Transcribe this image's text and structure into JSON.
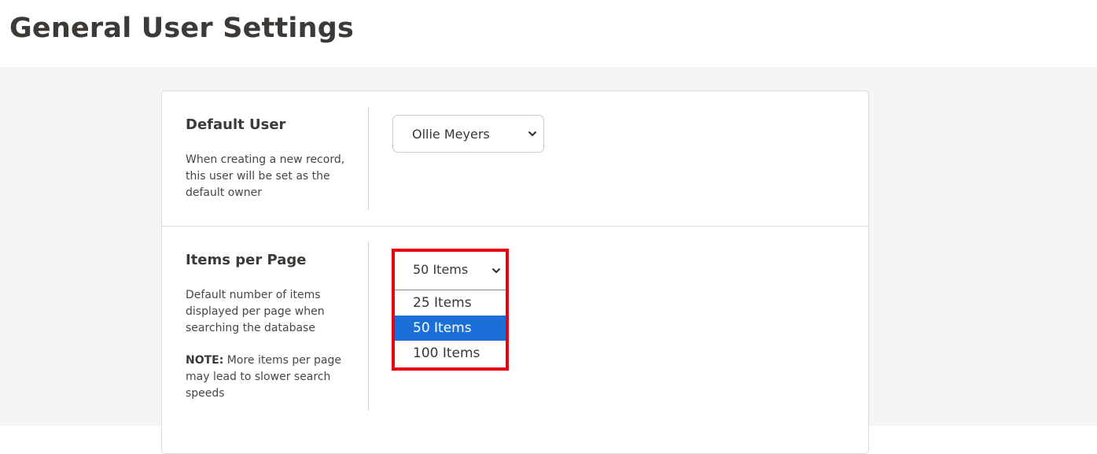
{
  "page": {
    "title": "General User Settings"
  },
  "settings": {
    "default_user": {
      "title": "Default User",
      "description": "When creating a new record, this user will be set as the default owner",
      "selected_value": "Ollie Meyers"
    },
    "items_per_page": {
      "title": "Items per Page",
      "description": "Default number of items displayed per page when searching the database",
      "note_label": "NOTE:",
      "note_text": " More items per page may lead to slower search speeds",
      "selected_value": "50 Items",
      "options": [
        "25 Items",
        "50 Items",
        "100 Items"
      ],
      "selected_index": 1
    }
  },
  "colors": {
    "highlight_border": "#e8000e",
    "selected_option_bg": "#1a6fd8",
    "content_bg": "#f4f4f2"
  },
  "icons": {
    "dropdown_arrow": "chevron-down-icon"
  }
}
